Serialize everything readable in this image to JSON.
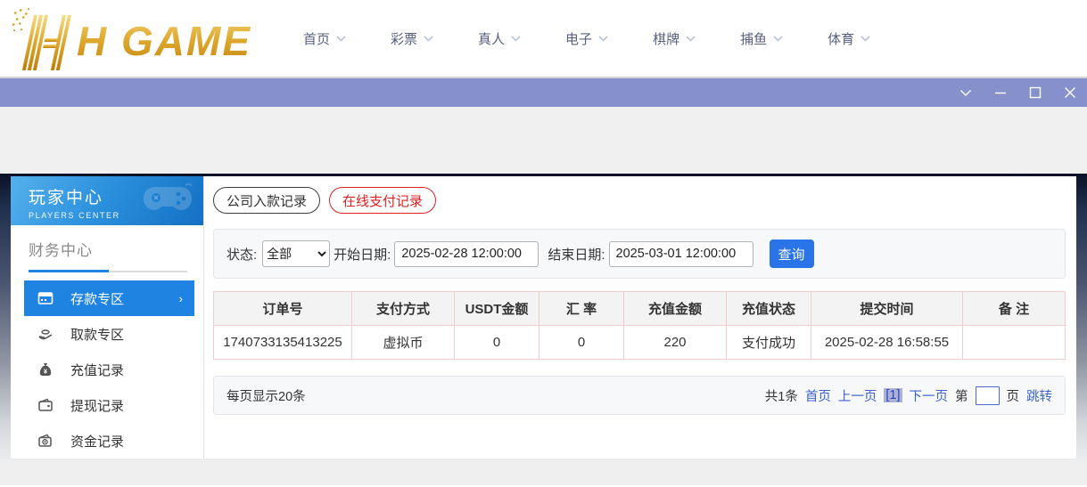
{
  "brand": {
    "logo_text": "H GAME"
  },
  "nav": {
    "items": [
      {
        "label": "首页"
      },
      {
        "label": "彩票"
      },
      {
        "label": "真人"
      },
      {
        "label": "电子"
      },
      {
        "label": "棋牌"
      },
      {
        "label": "捕鱼"
      },
      {
        "label": "体育"
      }
    ]
  },
  "titlebar": {
    "controls": [
      {
        "icon": "chevron-down-icon"
      },
      {
        "icon": "minimize-icon"
      },
      {
        "icon": "maximize-icon"
      },
      {
        "icon": "close-icon"
      }
    ]
  },
  "sidebar": {
    "title": "玩家中心",
    "subtitle": "PLAYERS CENTER",
    "section_title": "财务中心",
    "items": [
      {
        "label": "存款专区",
        "icon": "deposit-card-icon",
        "active": true
      },
      {
        "label": "取款专区",
        "icon": "withdraw-hand-icon",
        "active": false
      },
      {
        "label": "充值记录",
        "icon": "recharge-bag-icon",
        "active": false
      },
      {
        "label": "提现记录",
        "icon": "wallet-icon",
        "active": false
      },
      {
        "label": "资金记录",
        "icon": "funds-bag-icon",
        "active": false
      }
    ],
    "active_arrow": "›"
  },
  "main": {
    "tabs": [
      {
        "label": "公司入款记录",
        "active": false
      },
      {
        "label": "在线支付记录",
        "active": true
      }
    ],
    "filter": {
      "status_label": "状态:",
      "status_value": "全部",
      "start_label": "开始日期:",
      "start_value": "2025-02-28 12:00:00",
      "end_label": "结束日期:",
      "end_value": "2025-03-01 12:00:00",
      "query_label": "查询"
    },
    "table": {
      "headers": [
        "订单号",
        "支付方式",
        "USDT金额",
        "汇 率",
        "充值金额",
        "充值状态",
        "提交时间",
        "备 注"
      ],
      "rows": [
        [
          "1740733135413225",
          "虚拟币",
          "0",
          "0",
          "220",
          "支付成功",
          "2025-02-28 16:58:55",
          ""
        ]
      ]
    },
    "pagination": {
      "per_page": "每页显示20条",
      "total": "共1条",
      "first": "首页",
      "prev": "上一页",
      "current": "[1]",
      "next": "下一页",
      "jump_prefix": "第",
      "jump_suffix": "页",
      "jump": "跳转"
    }
  },
  "colors": {
    "accent_blue": "#1f83e2",
    "button_blue": "#2874e8",
    "link_blue": "#3c64cc",
    "tab_red": "#e02121",
    "titlebar_purple": "#8690cb",
    "logo_gold": "#d89b20"
  }
}
